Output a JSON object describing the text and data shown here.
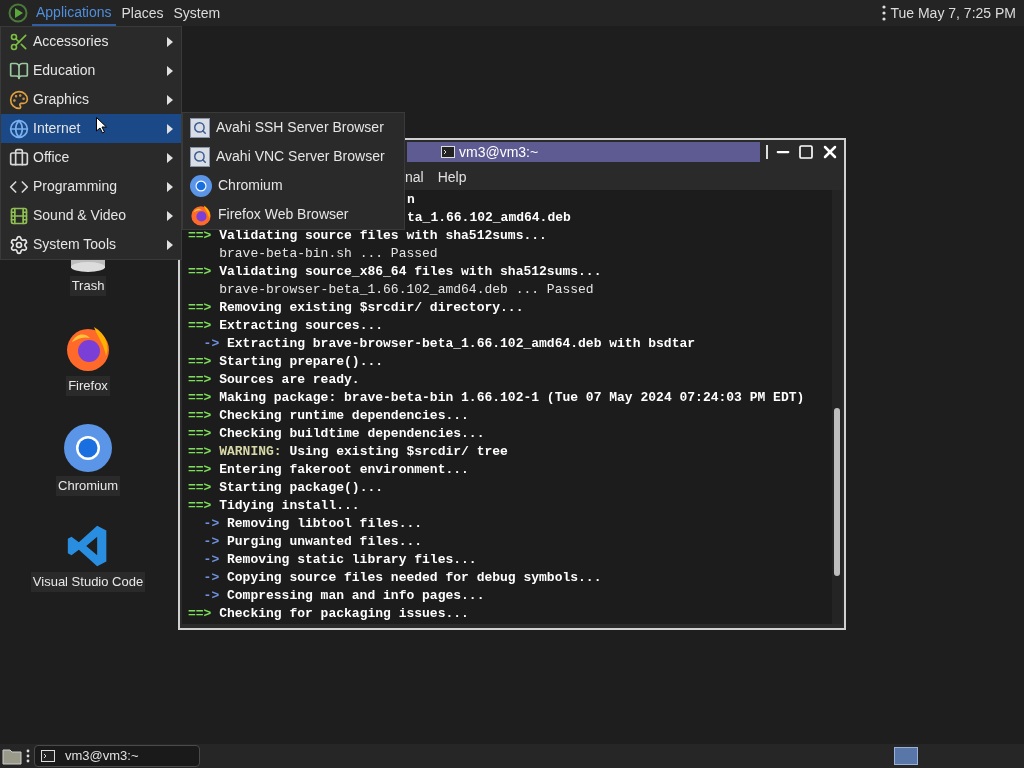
{
  "top_panel": {
    "menus": [
      {
        "label": "Applications",
        "selected": true
      },
      {
        "label": "Places",
        "selected": false
      },
      {
        "label": "System",
        "selected": false
      }
    ],
    "clock": "Tue May 7, 7:25 PM"
  },
  "applications_menu": {
    "items": [
      {
        "label": "Accessories",
        "selected": false
      },
      {
        "label": "Education",
        "selected": false
      },
      {
        "label": "Graphics",
        "selected": false
      },
      {
        "label": "Internet",
        "selected": true
      },
      {
        "label": "Office",
        "selected": false
      },
      {
        "label": "Programming",
        "selected": false
      },
      {
        "label": "Sound & Video",
        "selected": false
      },
      {
        "label": "System Tools",
        "selected": false
      }
    ]
  },
  "internet_submenu": {
    "items": [
      {
        "label": "Avahi SSH Server Browser",
        "kind": "avahi"
      },
      {
        "label": "Avahi VNC Server Browser",
        "kind": "avahi"
      },
      {
        "label": "Chromium",
        "kind": "chromium"
      },
      {
        "label": "Firefox Web Browser",
        "kind": "firefox"
      }
    ]
  },
  "desktop_icons": [
    {
      "label": "Trash",
      "kind": "trash"
    },
    {
      "label": "Firefox",
      "kind": "firefox"
    },
    {
      "label": "Chromium",
      "kind": "chromium"
    },
    {
      "label": "Visual Studio Code",
      "kind": "vscode"
    }
  ],
  "terminal": {
    "title": "vm3@vm3:~",
    "menus": [
      "nal",
      "Help"
    ],
    "lines": [
      {
        "kind": "clipped",
        "text": "n"
      },
      {
        "kind": "clipped",
        "text": "ta_1.66.102_amd64.deb"
      },
      {
        "kind": "step",
        "prefix": "==>",
        "text": "Validating source files with sha512sums..."
      },
      {
        "kind": "plain",
        "text": "brave-beta-bin.sh ... Passed"
      },
      {
        "kind": "step",
        "prefix": "==>",
        "text": "Validating source_x86_64 files with sha512sums..."
      },
      {
        "kind": "plain",
        "text": "brave-browser-beta_1.66.102_amd64.deb ... Passed"
      },
      {
        "kind": "step",
        "prefix": "==>",
        "text": "Removing existing $srcdir/ directory..."
      },
      {
        "kind": "step",
        "prefix": "==>",
        "text": "Extracting sources..."
      },
      {
        "kind": "sub",
        "prefix": "->",
        "text": "Extracting brave-browser-beta_1.66.102_amd64.deb with bsdtar"
      },
      {
        "kind": "step",
        "prefix": "==>",
        "text": "Starting prepare()..."
      },
      {
        "kind": "step",
        "prefix": "==>",
        "text": "Sources are ready."
      },
      {
        "kind": "step",
        "prefix": "==>",
        "text": "Making package: brave-beta-bin 1.66.102-1 (Tue 07 May 2024 07:24:03 PM EDT)"
      },
      {
        "kind": "step",
        "prefix": "==>",
        "text": "Checking runtime dependencies..."
      },
      {
        "kind": "step",
        "prefix": "==>",
        "text": "Checking buildtime dependencies..."
      },
      {
        "kind": "warning",
        "prefix": "==>",
        "label": "WARNING:",
        "text": "Using existing $srcdir/ tree"
      },
      {
        "kind": "step",
        "prefix": "==>",
        "text": "Entering fakeroot environment..."
      },
      {
        "kind": "step",
        "prefix": "==>",
        "text": "Starting package()..."
      },
      {
        "kind": "step",
        "prefix": "==>",
        "text": "Tidying install..."
      },
      {
        "kind": "sub",
        "prefix": "->",
        "text": "Removing libtool files..."
      },
      {
        "kind": "sub",
        "prefix": "->",
        "text": "Purging unwanted files..."
      },
      {
        "kind": "sub",
        "prefix": "->",
        "text": "Removing static library files..."
      },
      {
        "kind": "sub",
        "prefix": "->",
        "text": "Copying source files needed for debug symbols..."
      },
      {
        "kind": "sub",
        "prefix": "->",
        "text": "Compressing man and info pages..."
      },
      {
        "kind": "step",
        "prefix": "==>",
        "text": "Checking for packaging issues..."
      }
    ]
  },
  "bottom_panel": {
    "tasks": [
      {
        "label": "vm3@vm3:~"
      }
    ],
    "workspaces": [
      {
        "selected": true
      }
    ]
  }
}
